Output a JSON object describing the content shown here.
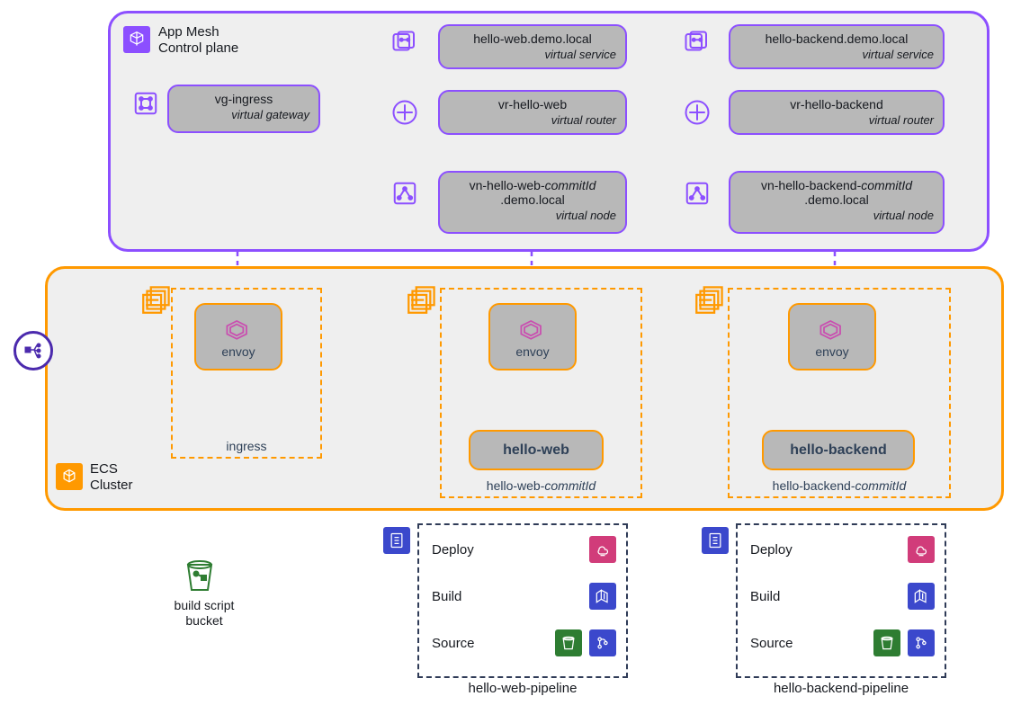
{
  "appmesh": {
    "title_l1": "App Mesh",
    "title_l2": "Control plane",
    "vg": {
      "name": "vg-ingress",
      "type": "virtual gateway"
    },
    "web": {
      "svc": {
        "name": "hello-web.demo.local",
        "type": "virtual service"
      },
      "router": {
        "name": "vr-hello-web",
        "type": "virtual router"
      },
      "node": {
        "name_pre": "vn-hello-web-",
        "name_commit": "commitId",
        "name_post": ".demo.local",
        "type": "virtual node"
      }
    },
    "backend": {
      "svc": {
        "name": "hello-backend.demo.local",
        "type": "virtual service"
      },
      "router": {
        "name": "vr-hello-backend",
        "type": "virtual router"
      },
      "node": {
        "name_pre": "vn-hello-backend-",
        "name_commit": "commitId",
        "name_post": ".demo.local",
        "type": "virtual node"
      }
    }
  },
  "ecs": {
    "title_l1": "ECS",
    "title_l2": "Cluster",
    "envoy_label": "envoy",
    "ingress_group": "ingress",
    "web": {
      "box": "hello-web",
      "group_pre": "hello-web-",
      "group_commit": "commitId"
    },
    "backend": {
      "box": "hello-backend",
      "group_pre": "hello-backend-",
      "group_commit": "commitId"
    }
  },
  "bucket_label_l1": "build script",
  "bucket_label_l2": "bucket",
  "pipeline": {
    "stages": {
      "deploy": "Deploy",
      "build": "Build",
      "source": "Source"
    },
    "web_label": "hello-web-pipeline",
    "backend_label": "hello-backend-pipeline"
  }
}
